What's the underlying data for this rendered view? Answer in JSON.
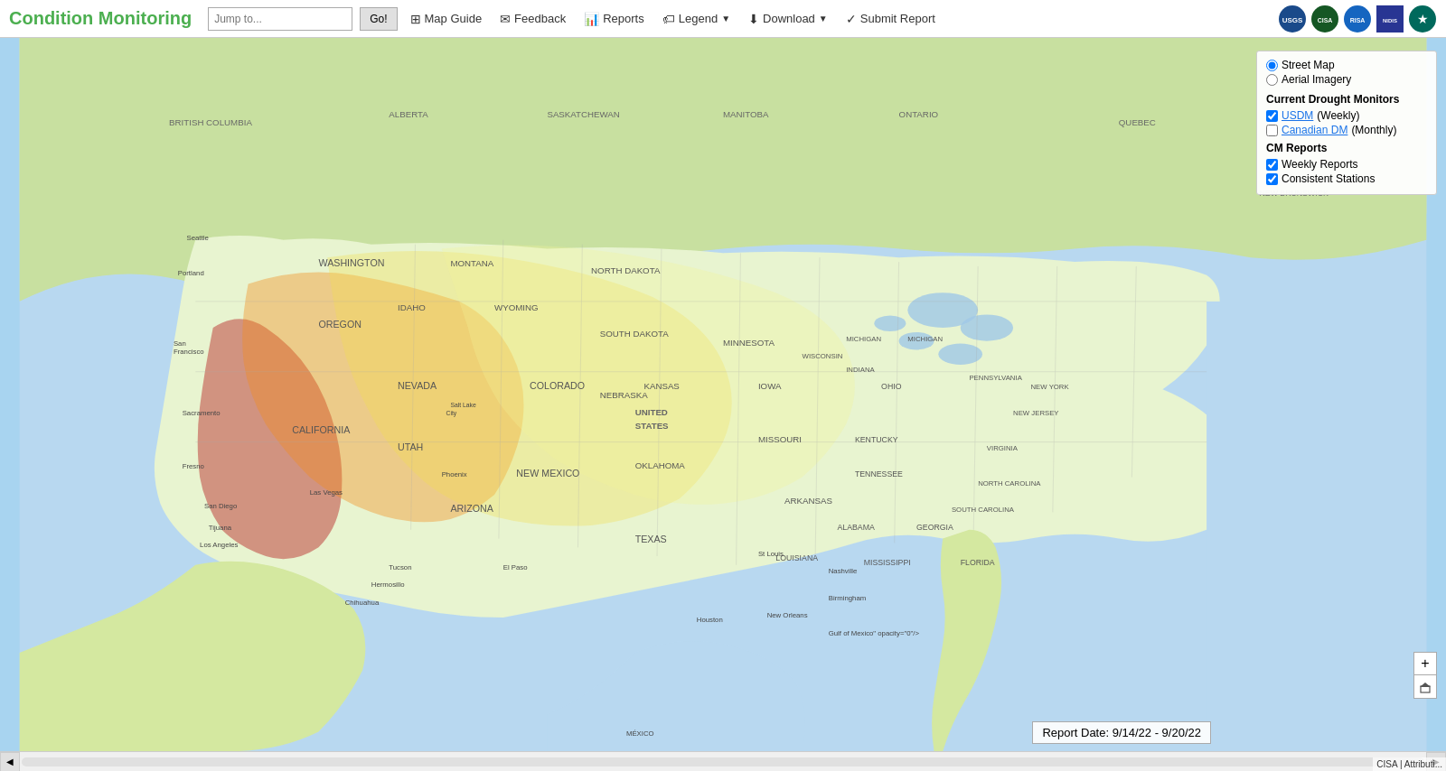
{
  "header": {
    "title": "Condition Monitoring",
    "jump_placeholder": "Jump to...",
    "go_label": "Go!",
    "nav_items": [
      {
        "id": "map-guide",
        "icon": "⊞",
        "label": "Map Guide"
      },
      {
        "id": "feedback",
        "icon": "✉",
        "label": "Feedback"
      },
      {
        "id": "reports",
        "icon": "📊",
        "label": "Reports"
      },
      {
        "id": "legend",
        "icon": "🏷",
        "label": "Legend",
        "has_dropdown": true
      },
      {
        "id": "download",
        "icon": "⬇",
        "label": "Download",
        "has_dropdown": true
      },
      {
        "id": "submit-report",
        "icon": "✓",
        "label": "Submit Report"
      }
    ]
  },
  "side_panel": {
    "map_type_label": "Street Map",
    "map_type_aerial": "Aerial Imagery",
    "current_drought_title": "Current Drought Monitors",
    "usdm_label": "USDM",
    "usdm_suffix": "(Weekly)",
    "usdm_checked": true,
    "canadian_label": "Canadian DM",
    "canadian_suffix": "(Monthly)",
    "canadian_checked": false,
    "cm_reports_title": "CM Reports",
    "weekly_reports_label": "Weekly Reports",
    "weekly_reports_checked": true,
    "consistent_stations_label": "Consistent Stations",
    "consistent_stations_checked": true
  },
  "report_date": {
    "label": "Report Date: 9/14/22 - 9/20/22"
  },
  "bottom_bar": {
    "attribution": "CISA | Attributi..."
  },
  "logos": [
    {
      "id": "logo1",
      "color": "#1a4a8a",
      "text": "USGS"
    },
    {
      "id": "logo2",
      "color": "#2e7d32",
      "text": "CISA"
    },
    {
      "id": "logo3",
      "color": "#1565c0",
      "text": "RISA"
    },
    {
      "id": "logo4",
      "color": "#4a148c",
      "text": "NIDIS"
    },
    {
      "id": "logo5",
      "color": "#00695c",
      "text": "★"
    }
  ]
}
